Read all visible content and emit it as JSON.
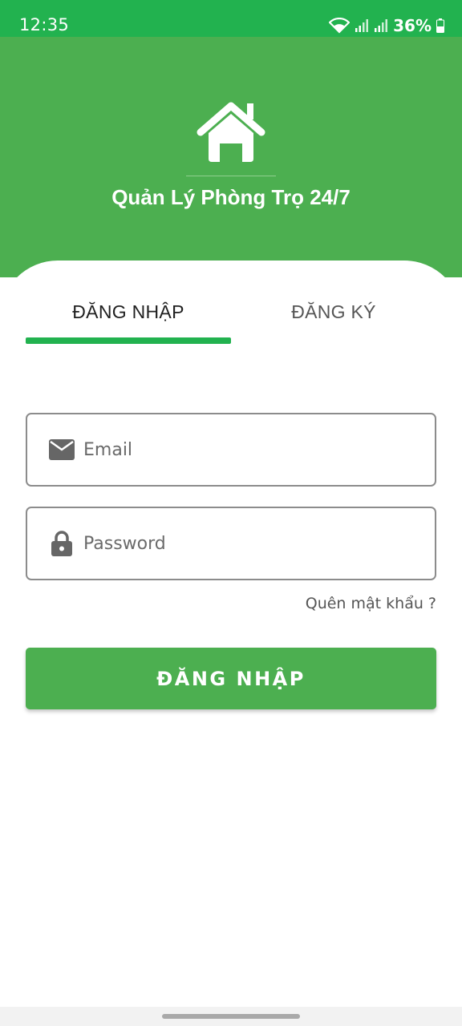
{
  "status_bar": {
    "time": "12:35",
    "battery_percent": "36%",
    "icons": [
      "wifi-icon",
      "signal-icon",
      "signal-icon",
      "battery-icon"
    ]
  },
  "header": {
    "title": "Quản Lý Phòng Trọ 24/7",
    "logo_icon": "home-icon"
  },
  "tabs": {
    "login_label": "ĐĂNG NHẬP",
    "register_label": "ĐĂNG KÝ",
    "active": "login"
  },
  "form": {
    "email": {
      "placeholder": "Email",
      "value": "",
      "icon": "mail-icon"
    },
    "password": {
      "placeholder": "Password",
      "value": "",
      "icon": "lock-icon"
    },
    "forgot_label": "Quên mật khẩu ?",
    "submit_label": "ĐĂNG NHẬP"
  },
  "colors": {
    "status_bar": "#22b24f",
    "primary": "#4caf50",
    "tab_indicator": "#22b24f"
  }
}
